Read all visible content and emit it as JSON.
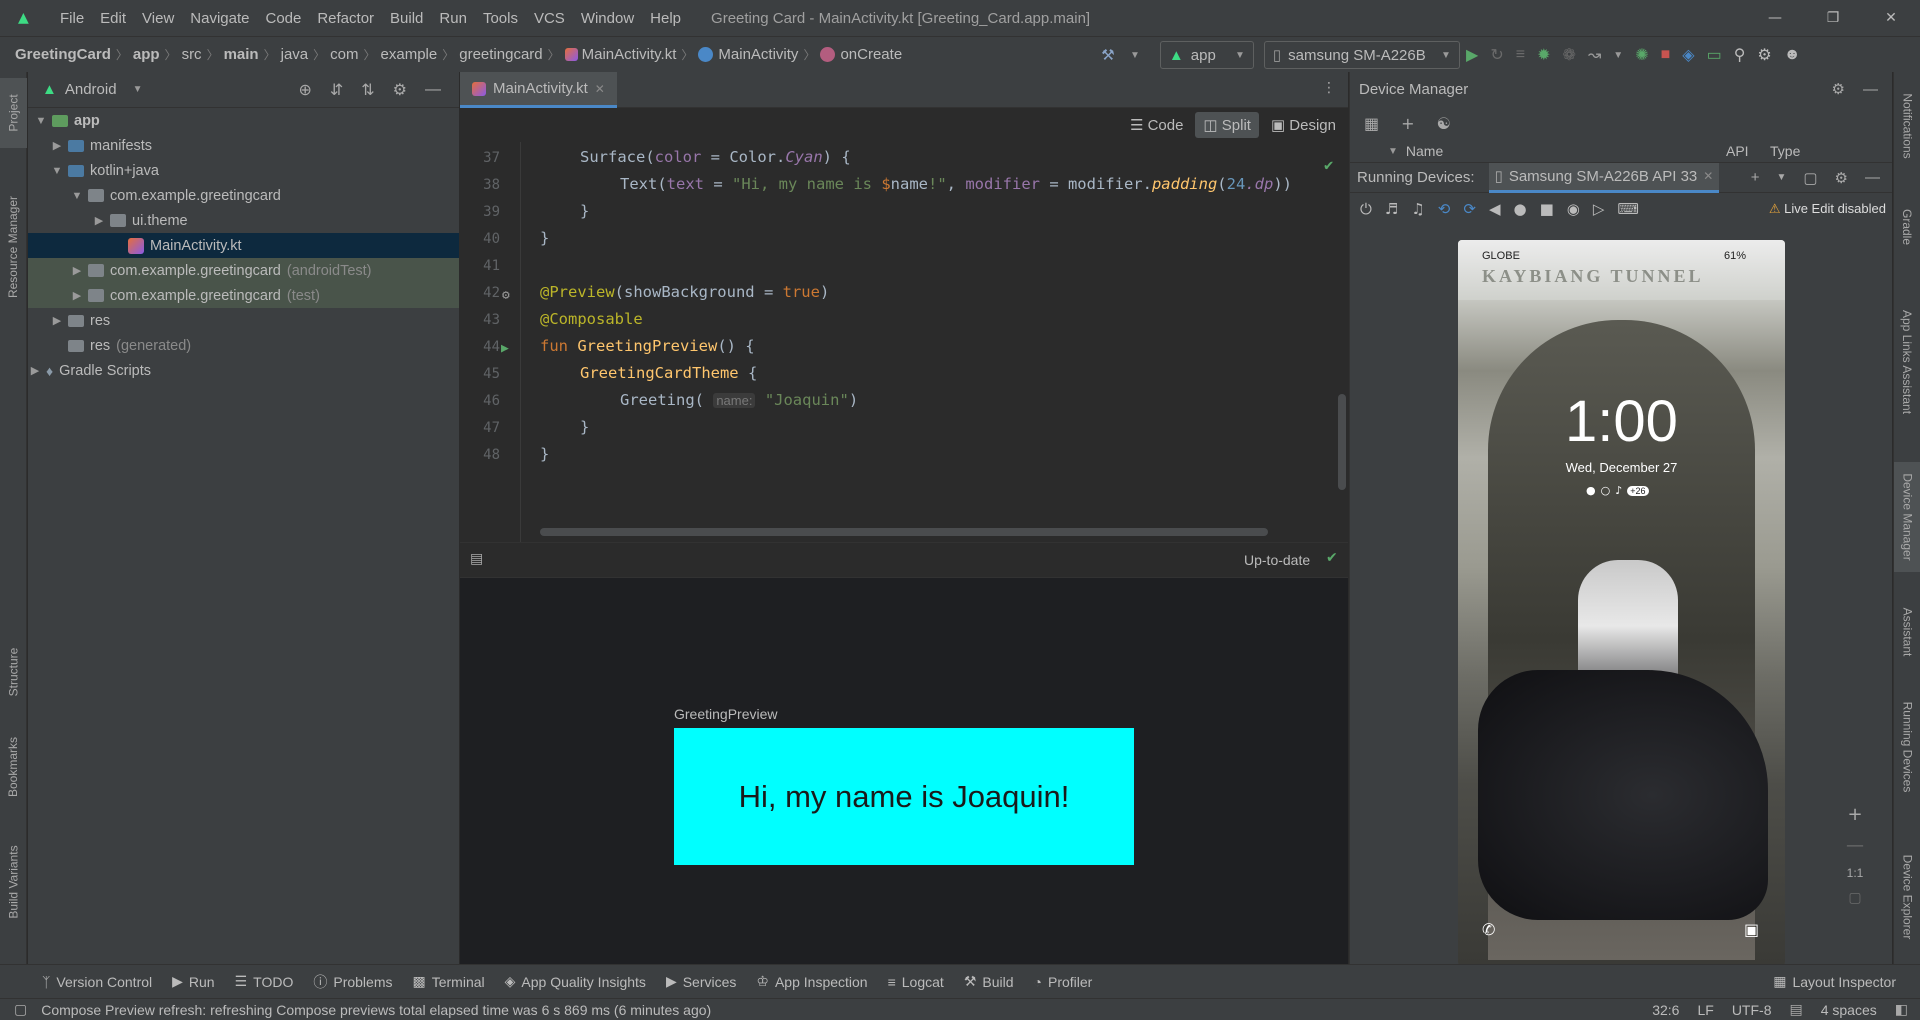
{
  "menu": [
    "File",
    "Edit",
    "View",
    "Navigate",
    "Code",
    "Refactor",
    "Build",
    "Run",
    "Tools",
    "VCS",
    "Window",
    "Help"
  ],
  "window_title": "Greeting Card - MainActivity.kt [Greeting_Card.app.main]",
  "breadcrumb": [
    "GreetingCard",
    "app",
    "src",
    "main",
    "java",
    "com",
    "example",
    "greetingcard",
    "MainActivity.kt",
    "MainActivity",
    "onCreate"
  ],
  "run_config": "app",
  "device_select": "samsung SM-A226B",
  "left_tabs": [
    "Project",
    "Resource Manager",
    "Structure",
    "Bookmarks",
    "Build Variants"
  ],
  "right_tabs": [
    "Notifications",
    "Gradle",
    "App Links Assistant",
    "Device Manager",
    "Assistant",
    "Running Devices",
    "Device Explorer"
  ],
  "project": {
    "view": "Android",
    "tree": [
      {
        "label": "app",
        "extra": "",
        "bold": true
      },
      {
        "label": "manifests",
        "extra": ""
      },
      {
        "label": "kotlin+java",
        "extra": ""
      },
      {
        "label": "com.example.greetingcard",
        "extra": ""
      },
      {
        "label": "ui.theme",
        "extra": ""
      },
      {
        "label": "MainActivity.kt",
        "extra": ""
      },
      {
        "label": "com.example.greetingcard",
        "extra": "(androidTest)"
      },
      {
        "label": "com.example.greetingcard",
        "extra": "(test)"
      },
      {
        "label": "res",
        "extra": ""
      },
      {
        "label": "res",
        "extra": "(generated)"
      },
      {
        "label": "Gradle Scripts",
        "extra": ""
      }
    ]
  },
  "editor": {
    "tab": "MainActivity.kt",
    "views": [
      "Code",
      "Split",
      "Design"
    ],
    "line_numbers": [
      "37",
      "38",
      "39",
      "40",
      "41",
      "42",
      "43",
      "44",
      "45",
      "46",
      "47",
      "48"
    ],
    "code": {
      "l37a": "Surface(",
      "l37b": "color",
      "l37c": " = Color.",
      "l37d": "Cyan",
      "l37e": ") {",
      "l38a": "Text(",
      "l38b": "text",
      "l38c": " = ",
      "l38d": "\"Hi, my name is ",
      "l38e": "$",
      "l38f": "name",
      "l38g": "!\"",
      "l38h": ", ",
      "l38i": "modifier",
      "l38j": " = modifier.",
      "l38k": "padding",
      "l38l": "(",
      "l38m": "24",
      "l38n": ".dp",
      "l38o": "))",
      "l39": "}",
      "l40": "}",
      "l42a": "@Preview",
      "l42b": "(showBackground = ",
      "l42c": "true",
      "l42d": ")",
      "l43": "@Composable",
      "l44a": "fun ",
      "l44b": "GreetingPreview",
      "l44c": "() {",
      "l45a": "GreetingCardTheme",
      "l45b": " {",
      "l46a": "Greeting( ",
      "l46b": "name:",
      "l46c": "\"Joaquin\"",
      "l46d": ")",
      "l47": "}",
      "l48": "}"
    },
    "preview_status": "Up-to-date",
    "preview_name": "GreetingPreview",
    "preview_text": "Hi, my name is Joaquin!"
  },
  "device_manager": {
    "title": "Device Manager",
    "col_name": "Name",
    "col_api": "API",
    "col_type": "Type",
    "running_label": "Running Devices:",
    "running_tab": "Samsung SM-A226B API 33",
    "live_edit": "Live Edit disabled",
    "phone": {
      "carrier": "GLOBE",
      "battery": "61%",
      "sign": "KAYBIANG TUNNEL",
      "time": "1:00",
      "date": "Wed, December 27",
      "notif_count": "+26"
    },
    "zoom_ratio": "1:1"
  },
  "toolstrip": [
    "Version Control",
    "Run",
    "TODO",
    "Problems",
    "Terminal",
    "App Quality Insights",
    "Services",
    "App Inspection",
    "Logcat",
    "Build",
    "Profiler"
  ],
  "layout_inspector": "Layout Inspector",
  "status": {
    "message": "Compose Preview refresh: refreshing Compose previews total elapsed time was 6 s 869 ms (6 minutes ago)",
    "position": "32:6",
    "line_sep": "LF",
    "encoding": "UTF-8",
    "indent": "4 spaces"
  }
}
